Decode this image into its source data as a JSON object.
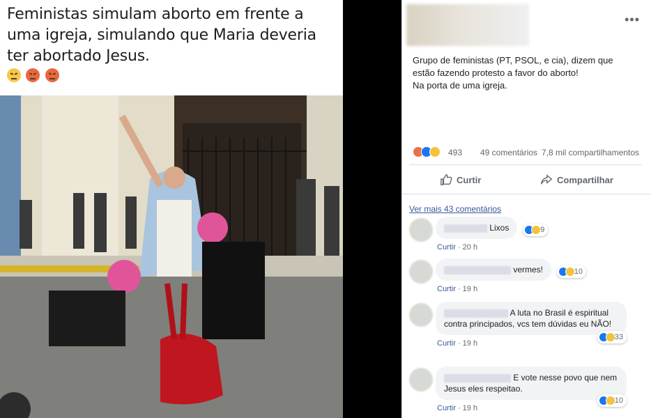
{
  "left_post": {
    "caption": "Feministas simulam aborto em frente a uma igreja, simulando que Maria deveria ter abortado Jesus.",
    "emojis": [
      "angry-face-icon",
      "pouting-face-icon",
      "pouting-face-icon"
    ]
  },
  "right_post": {
    "text_lines": [
      "Grupo de feministas (PT, PSOL, e cia), dizem que",
      "estão fazendo protesto a favor do aborto!",
      "Na porta de uma igreja."
    ],
    "reactions_count": "493",
    "comments_count": "49 comentários",
    "shares_count": "7,8 mil compartilhamentos",
    "like_label": "Curtir",
    "share_label": "Compartilhar",
    "more_comments": "Ver mais 43 comentários",
    "comments": [
      {
        "text": "Lixos",
        "reactions": "9",
        "action": "Curtir",
        "time": "20 h"
      },
      {
        "text": "vermes!",
        "reactions": "10",
        "action": "Curtir",
        "time": "19 h"
      },
      {
        "text": "A luta no Brasil é espiritual contra principados, vcs tem dúvidas eu NÃO!",
        "reactions": "33",
        "action": "Curtir",
        "time": "19 h"
      },
      {
        "text": "E vote nesse povo que nem Jesus eles respeitao.",
        "reactions": "10",
        "action": "Curtir",
        "time": "19 h"
      }
    ]
  },
  "colors": {
    "link": "#385898",
    "like_blue": "#1877f2",
    "angry": "#e9714a"
  }
}
